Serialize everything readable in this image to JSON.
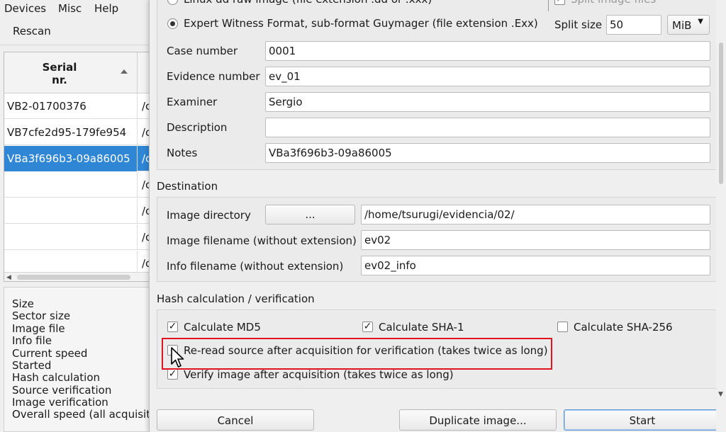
{
  "menubar": {
    "items": [
      "Devices",
      "Misc",
      "Help"
    ]
  },
  "toolbar": {
    "rescan_label": "Rescan"
  },
  "device_table": {
    "header_serial": "Serial\nnr.",
    "rows": [
      {
        "serial": "VB2-01700376",
        "path": "/c"
      },
      {
        "serial": "VB7cfe2d95-179fe954",
        "path": "/c"
      },
      {
        "serial": "VBa3f696b3-09a86005",
        "path": "/c",
        "selected": true
      },
      {
        "serial": "",
        "path": "/c"
      },
      {
        "serial": "",
        "path": "/c"
      },
      {
        "serial": "",
        "path": "/c"
      },
      {
        "serial": "",
        "path": "/c"
      }
    ]
  },
  "info_panel": {
    "labels": [
      "Size",
      "Sector size",
      "Image file",
      "Info file",
      "Current speed",
      "Started",
      "Hash calculation",
      "Source verification",
      "Image verification",
      "Overall speed (all acquisit"
    ]
  },
  "dialog": {
    "format_option_linux": "Linux dd raw image (file extension .dd or .xxx)",
    "format_option_expert": "Expert Witness Format, sub-format Guymager (file extension .Exx)",
    "split_files_label": "Split image files",
    "split_size_label": "Split size",
    "split_size_value": "50",
    "split_unit": "MiB",
    "fields": {
      "case_number": {
        "label": "Case number",
        "value": "0001"
      },
      "evidence_number": {
        "label": "Evidence number",
        "value": "ev_01"
      },
      "examiner": {
        "label": "Examiner",
        "value": "Sergio"
      },
      "description": {
        "label": "Description",
        "value": ""
      },
      "notes": {
        "label": "Notes",
        "value": "VBa3f696b3-09a86005"
      }
    },
    "destination": {
      "title": "Destination",
      "image_directory_label": "Image directory",
      "browse_label": "...",
      "image_directory_value": "/home/tsurugi/evidencia/02/",
      "image_filename_label": "Image filename (without extension)",
      "image_filename_value": "ev02",
      "info_filename_label": "Info filename (without extension)",
      "info_filename_value": "ev02_info"
    },
    "hash": {
      "title": "Hash calculation / verification",
      "md5_label": "Calculate MD5",
      "sha1_label": "Calculate SHA-1",
      "sha256_label": "Calculate SHA-256",
      "reread_label": "Re-read source after acquisition for verification (takes twice as long)",
      "verify_label": "Verify image after acquisition (takes twice as long)"
    },
    "buttons": {
      "cancel": "Cancel",
      "duplicate": "Duplicate image...",
      "start": "Start"
    }
  }
}
